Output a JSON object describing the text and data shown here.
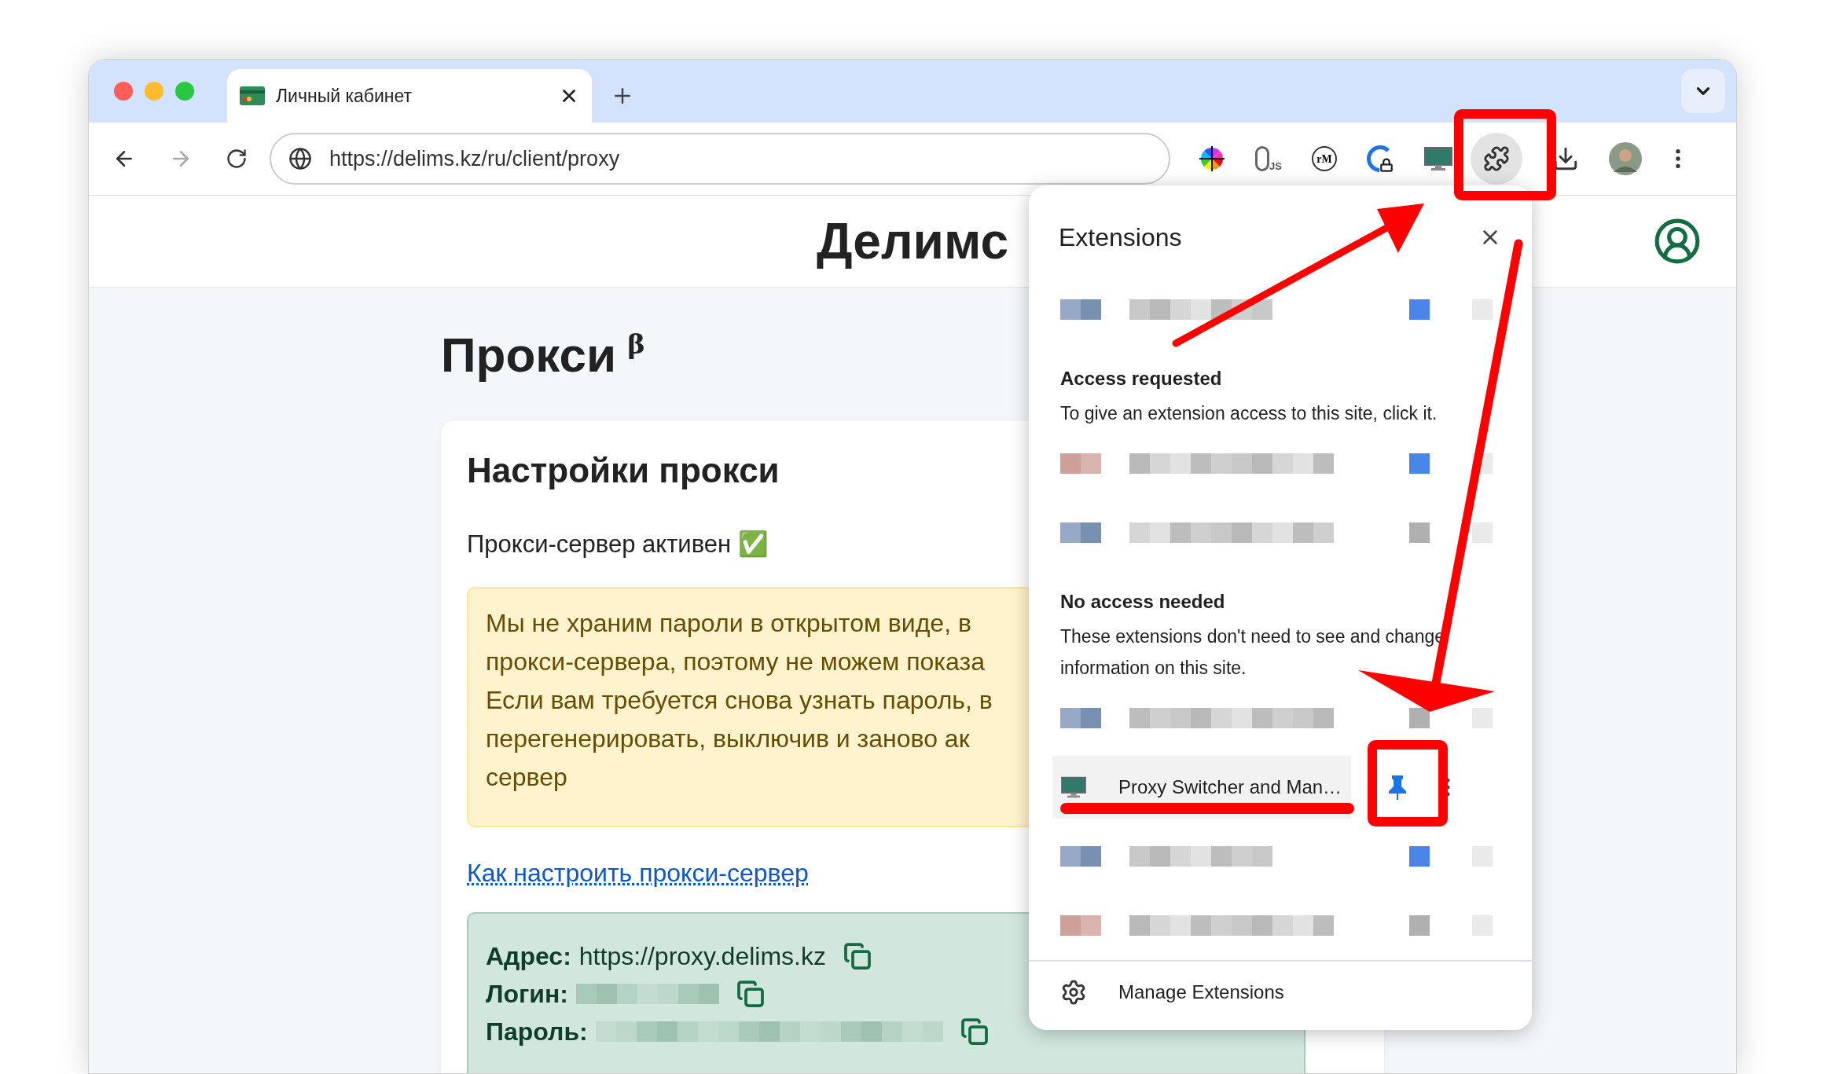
{
  "browser": {
    "tabs": [
      {
        "title": "Личный кабинет",
        "selected": true
      }
    ],
    "forward_disabled": true,
    "address": "https://delims.kz/ru/client/proxy",
    "toolbar_extensions": [
      {
        "kind": "color-wheel"
      },
      {
        "kind": "js",
        "label": "JS"
      },
      {
        "kind": "rm",
        "label": "rM"
      },
      {
        "kind": "lock"
      },
      {
        "kind": "monitor"
      }
    ],
    "extensions_button_active": true
  },
  "page": {
    "site_title": "Делимс",
    "heading": "Прокси",
    "heading_mark": "β",
    "card_title": "Настройки прокси",
    "status": "Прокси-сервер активен ✅",
    "notice_lines": [
      "Мы не храним пароли в открытом виде, в",
      "прокси-сервера, поэтому не можем показа",
      "Если вам требуется снова узнать пароль, в",
      "перегенерировать, выключив и заново ак",
      "сервер"
    ],
    "help_link": "Как настроить прокси-сервер",
    "credentials": [
      {
        "label": "Адрес:",
        "value": "https://proxy.delims.kz",
        "kind": "text"
      },
      {
        "label": "Логин:",
        "kind": "hidden"
      },
      {
        "label": "Пароль:",
        "kind": "hidden"
      }
    ]
  },
  "extensions_panel": {
    "title": "Extensions",
    "pinned_rows": [
      {
        "kind": "redacted",
        "pinned": true
      }
    ],
    "sections": [
      {
        "heading": "Access requested",
        "description": "To give an extension access to this site, click it.",
        "rows": [
          {
            "kind": "redacted",
            "pinned": true
          },
          {
            "kind": "redacted",
            "pinned": false
          }
        ]
      },
      {
        "heading": "No access needed",
        "description": "These extensions don't need to see and change information on this site.",
        "rows": [
          {
            "kind": "redacted",
            "pinned": false
          },
          {
            "kind": "extension",
            "name": "Proxy Switcher and Man…",
            "pinned": true,
            "highlighted": true
          },
          {
            "kind": "redacted",
            "pinned": true
          },
          {
            "kind": "redacted",
            "pinned": false
          }
        ]
      }
    ],
    "footer": "Manage Extensions"
  }
}
